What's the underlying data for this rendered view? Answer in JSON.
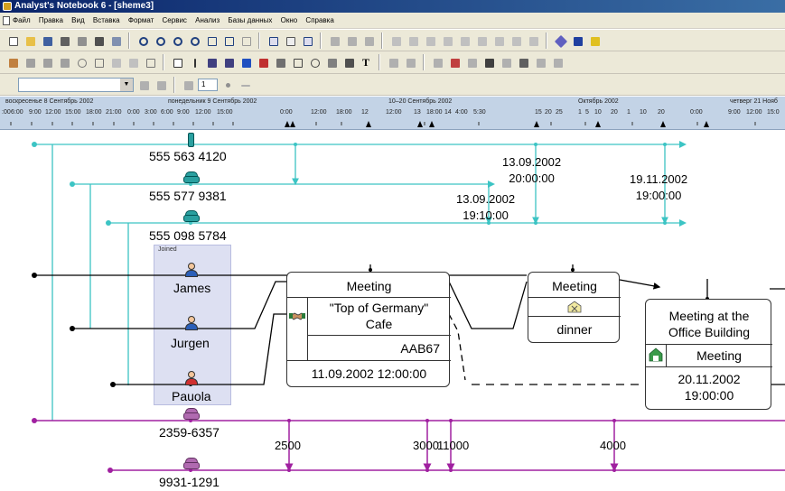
{
  "window": {
    "title": "Analyst's Notebook 6 - [sheme3]"
  },
  "menu": {
    "items": [
      "Файл",
      "Правка",
      "Вид",
      "Вставка",
      "Формат",
      "Сервис",
      "Анализ",
      "Базы данных",
      "Окно",
      "Справка"
    ]
  },
  "toolbar3": {
    "zoom_value": "1"
  },
  "timeline": {
    "top_labels": [
      "воскресенье 8 Сентябрь 2002",
      "понедельник 9 Сентябрь 2002",
      "10–20 Сентябрь 2002",
      "Октябрь 2002",
      "четверг 21 Нояб"
    ],
    "bottom_labels": [
      ":00",
      "6:00",
      "9:00",
      "12:00",
      "15:00",
      "18:00",
      "21:00",
      "0:00",
      "3:00",
      "6:00",
      "9:00",
      "12:00",
      "15:00",
      "0:00",
      "12:00",
      "18:00",
      "12",
      "12:00",
      "13",
      "18:00",
      "14",
      "4:00",
      "5:30",
      "15",
      "20",
      "25",
      "1",
      "5",
      "10",
      "20",
      "1",
      "10",
      "20",
      "0:00",
      "9:00",
      "12:00",
      "15:0"
    ]
  },
  "phones": [
    {
      "number": "555 563 4120"
    },
    {
      "number": "555 577 9381"
    },
    {
      "number": "555 098 5784"
    },
    {
      "number": "2359-6357"
    },
    {
      "number": "9931-1291"
    }
  ],
  "calls": [
    {
      "date": "13.09.2002",
      "time": "20:00:00"
    },
    {
      "date": "13.09.2002",
      "time": "19:10:00"
    },
    {
      "date": "19.11.2002",
      "time": "19:00:00"
    }
  ],
  "group": {
    "label": "Joined"
  },
  "persons": [
    {
      "name": "James"
    },
    {
      "name": "Jurgen"
    },
    {
      "name": "Pauola"
    }
  ],
  "events": {
    "meeting1": {
      "title": "Meeting",
      "place": "\"Top of Germany\" Cafe",
      "code": "AAB67",
      "datetime": "11.09.2002 12:00:00"
    },
    "meeting2": {
      "title": "Meeting",
      "detail": "dinner"
    },
    "meeting3": {
      "title": "Meeting at the Office Building",
      "type": "Meeting",
      "datetime": "20.11.2002 19:00:00"
    }
  },
  "transactions": [
    {
      "amount": "2500"
    },
    {
      "amount": "3000"
    },
    {
      "amount": "11000"
    },
    {
      "amount": "4000"
    }
  ],
  "colors": {
    "teal": "#3cc4c4",
    "purple": "#a020a0",
    "black": "#000000"
  }
}
